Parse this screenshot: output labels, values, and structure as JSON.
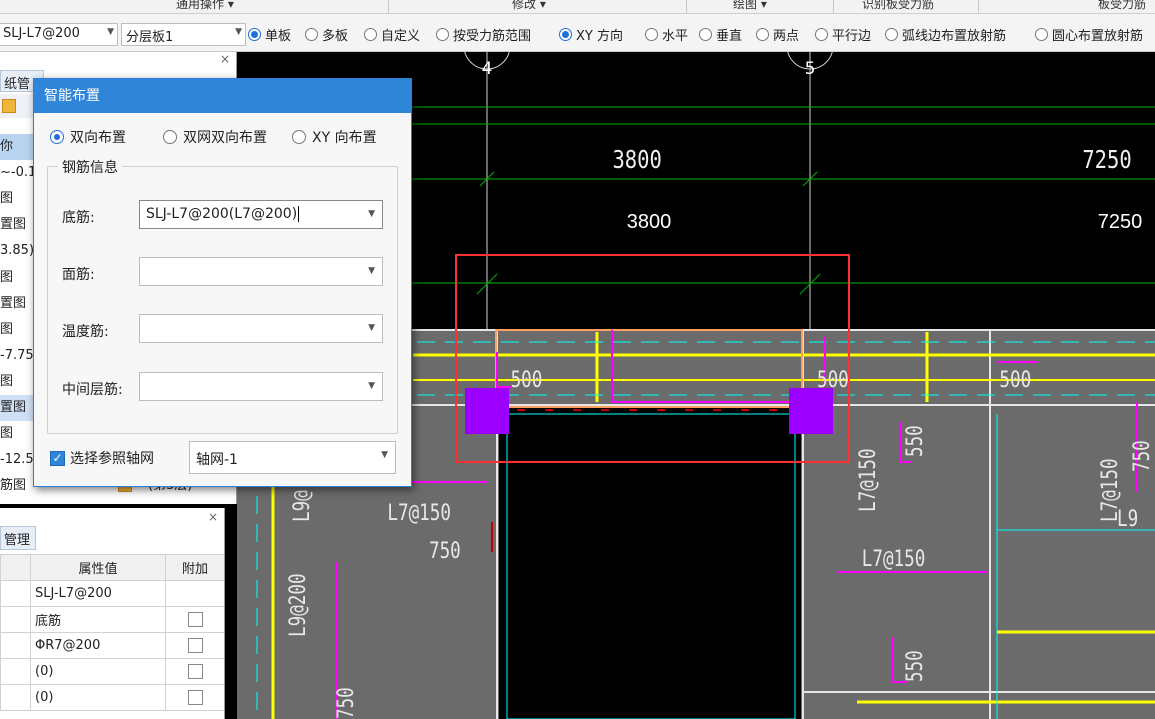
{
  "ribbon": {
    "groups": [
      {
        "label": "通用操作 ▾"
      },
      {
        "label": "修改 ▾"
      },
      {
        "label": "绘图 ▾"
      },
      {
        "label": "识别板受力筋"
      },
      {
        "label": "板受力筋"
      }
    ]
  },
  "toolbar": {
    "rebar_select": "SLJ-L7@200",
    "layer_select": "分层板1",
    "radios": [
      {
        "label": "单板",
        "checked": true
      },
      {
        "label": "多板",
        "checked": false
      },
      {
        "label": "自定义",
        "checked": false
      },
      {
        "label": "按受力筋范围",
        "checked": false
      },
      {
        "label": "XY 方向",
        "checked": true
      },
      {
        "label": "水平",
        "checked": false
      },
      {
        "label": "垂直",
        "checked": false
      },
      {
        "label": "两点",
        "checked": false
      },
      {
        "label": "平行边",
        "checked": false
      },
      {
        "label": "弧线边布置放射筋",
        "checked": false
      },
      {
        "label": "圆心布置放射筋",
        "checked": false
      }
    ]
  },
  "left_panel": {
    "tab": "纸管理",
    "close": "×",
    "rows": [
      "你",
      "~-0.1",
      "图",
      "置图",
      "3.85)",
      "图",
      "置图",
      "图",
      "-7.75",
      "图",
      "置图",
      "图",
      "-12.5",
      "筋图"
    ],
    "last_row_extra": "(第3层)"
  },
  "props_panel": {
    "tab": "管理",
    "close": "×",
    "headers": [
      "",
      "属性值",
      "附加"
    ],
    "rows": [
      {
        "value": "SLJ-L7@200",
        "check": false
      },
      {
        "value": "底筋",
        "check": true
      },
      {
        "value": "ΦR7@200",
        "check": true
      },
      {
        "value": "(0)",
        "check": true
      },
      {
        "value": "(0)",
        "check": true
      }
    ]
  },
  "dialog": {
    "title": "智能布置",
    "modes": [
      {
        "label": "双向布置",
        "checked": true
      },
      {
        "label": "双网双向布置",
        "checked": false
      },
      {
        "label": "XY 向布置",
        "checked": false
      }
    ],
    "group_label": "钢筋信息",
    "fields": [
      {
        "label": "底筋:",
        "value": "SLJ-L7@200(L7@200)"
      },
      {
        "label": "面筋:",
        "value": ""
      },
      {
        "label": "温度筋:",
        "value": ""
      },
      {
        "label": "中间层筋:",
        "value": ""
      }
    ],
    "grid_checkbox": "选择参照轴网",
    "grid_value": "轴网-1"
  },
  "drawing": {
    "axes": [
      "4",
      "5"
    ],
    "dims_top": [
      "3800",
      "7250"
    ],
    "dims_mid": [
      "3800",
      "7250"
    ],
    "labels": [
      "500",
      "500",
      "500",
      "550",
      "L7@150",
      "L7@150",
      "750",
      "L7@150",
      "L9@200",
      "L9@",
      "550",
      "750",
      "L7@150",
      "750",
      "L9"
    ],
    "colors": {
      "background": "#000000",
      "slab": "#6b6b6b",
      "beam_yellow": "#ffff00",
      "rebar_magenta": "#ff00ff",
      "cyan": "#00ffff",
      "green": "#00cc00",
      "selection": "#ff3030",
      "column": "#9b00ff"
    }
  }
}
